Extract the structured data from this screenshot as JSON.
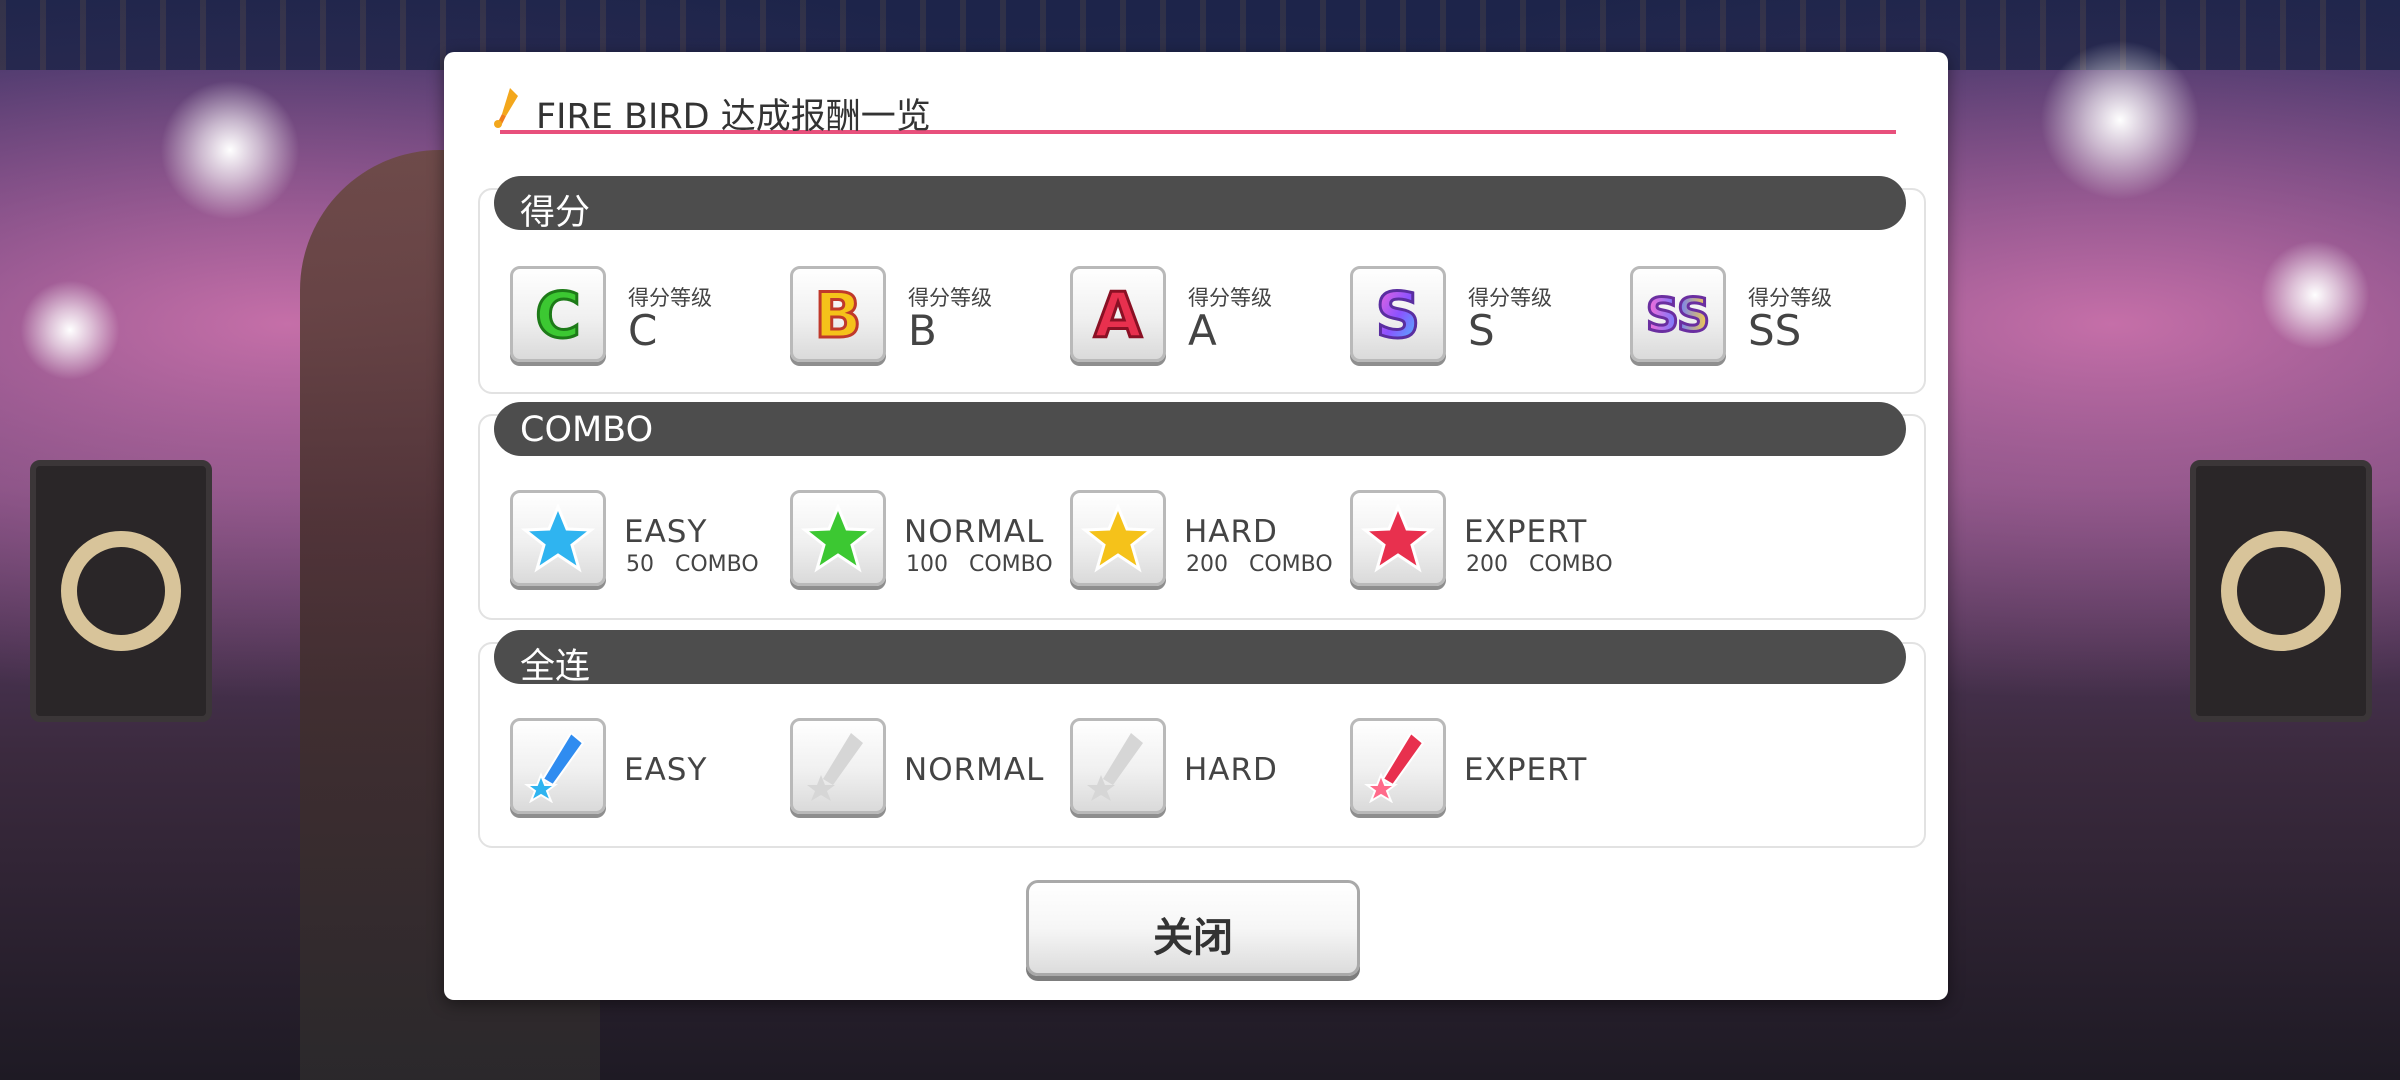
{
  "dialog": {
    "title": "FIRE BIRD 达成报酬一览",
    "close_label": "关闭"
  },
  "sections": {
    "score": {
      "header": "得分",
      "items": [
        {
          "icon": "rank-c-icon",
          "label_small": "得分等级",
          "label_big": "C",
          "color": "#3cc832"
        },
        {
          "icon": "rank-b-icon",
          "label_small": "得分等级",
          "label_big": "B",
          "color": "#f5c21a"
        },
        {
          "icon": "rank-a-icon",
          "label_small": "得分等级",
          "label_big": "A",
          "color": "#e8304e"
        },
        {
          "icon": "rank-s-icon",
          "label_small": "得分等级",
          "label_big": "S",
          "color": "#8c52ff"
        },
        {
          "icon": "rank-ss-icon",
          "label_small": "得分等级",
          "label_big": "SS",
          "color": "#6e7cff"
        }
      ]
    },
    "combo": {
      "header": "COMBO",
      "items": [
        {
          "icon": "star-blue-icon",
          "level": "EASY",
          "count": "50 COMBO",
          "color": "#2fb4f0"
        },
        {
          "icon": "star-green-icon",
          "level": "NORMAL",
          "count": "100 COMBO",
          "color": "#3cc832"
        },
        {
          "icon": "star-yellow-icon",
          "level": "HARD",
          "count": "200 COMBO",
          "color": "#f5c21a"
        },
        {
          "icon": "star-red-icon",
          "level": "EXPERT",
          "count": "200 COMBO",
          "color": "#e8304e"
        }
      ]
    },
    "full_combo": {
      "header": "全连",
      "items": [
        {
          "icon": "fullcombo-blue-icon",
          "level": "EASY",
          "achieved": true,
          "color": "#2f8cf0"
        },
        {
          "icon": "fullcombo-gray-icon",
          "level": "NORMAL",
          "achieved": false,
          "color": "#d0d0d0"
        },
        {
          "icon": "fullcombo-gray-icon",
          "level": "HARD",
          "achieved": false,
          "color": "#d0d0d0"
        },
        {
          "icon": "fullcombo-red-icon",
          "level": "EXPERT",
          "achieved": true,
          "color": "#e8304e"
        }
      ]
    }
  }
}
